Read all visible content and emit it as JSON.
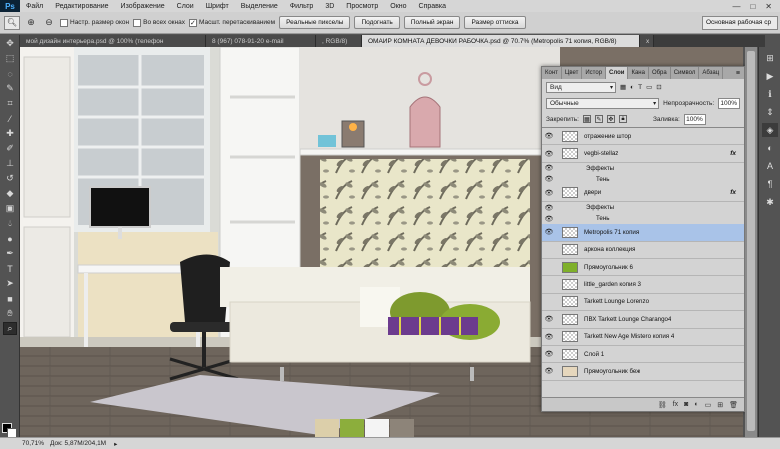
{
  "menubar": {
    "logo": "Ps",
    "items": [
      "Файл",
      "Редактирование",
      "Изображение",
      "Слои",
      "Шрифт",
      "Выделение",
      "Фильтр",
      "3D",
      "Просмотр",
      "Окно",
      "Справка"
    ],
    "window_controls": [
      "—",
      "□",
      "✕"
    ]
  },
  "options": {
    "resize_windows": "Настр. размер окон",
    "all_windows": "Во всех окнах",
    "scrubby_zoom": "Масшт. перетаскиванием",
    "actual_pixels": "Реальные пикселы",
    "fit_screen": "Подогнать",
    "fill_screen": "Полный экран",
    "print_size": "Размер оттиска",
    "workspace": "Основная рабочая ср"
  },
  "tabs": [
    {
      "label": "мой дизайн интерьера.psd @ 100% (телефон",
      "active": false
    },
    {
      "label": "8 (967) 078-91-20 e-mail",
      "active": false
    },
    {
      "label": ", RGB/8)",
      "active": false
    },
    {
      "label": "ОМАИР КОМНАТА ДЕВОЧКИ РАБОЧКА.psd @ 70.7% (Metropolis 71 копия, RGB/8)",
      "active": true
    },
    {
      "label": "x",
      "active": false
    }
  ],
  "layers_panel": {
    "tabs": [
      "Конт",
      "Цвет",
      "Истор",
      "Слои",
      "Кана",
      "Обра",
      "Символ",
      "Абзац"
    ],
    "active_tab": "Слои",
    "filter_kind": "Вид",
    "blend_mode": "Обычные",
    "opacity_label": "Непрозрачность:",
    "opacity_value": "100%",
    "lock_label": "Закрепить:",
    "fill_label": "Заливка:",
    "fill_value": "100%",
    "layers": [
      {
        "name": "отражение штор",
        "visible": true,
        "fx": false,
        "type": "layer"
      },
      {
        "name": "vegbi-stellaz",
        "visible": true,
        "fx": true,
        "type": "layer"
      },
      {
        "name": "Эффекты",
        "type": "effects"
      },
      {
        "name": "Тень",
        "type": "effect"
      },
      {
        "name": "двери",
        "visible": true,
        "fx": true,
        "type": "layer"
      },
      {
        "name": "Эффекты",
        "type": "effects"
      },
      {
        "name": "Тень",
        "type": "effect"
      },
      {
        "name": "Metropolis 71 копия",
        "visible": true,
        "fx": false,
        "type": "layer",
        "active": true
      },
      {
        "name": "арконa коллекция",
        "visible": false,
        "fx": false,
        "type": "layer"
      },
      {
        "name": "Прямоугольник 6",
        "visible": false,
        "fx": false,
        "type": "layer"
      },
      {
        "name": "little_garden копия 3",
        "visible": false,
        "fx": false,
        "type": "layer"
      },
      {
        "name": "Tarkett Lounge Lorenzo",
        "visible": false,
        "fx": false,
        "type": "layer"
      },
      {
        "name": "ПВХ Tarkett Lounge Charango4",
        "visible": true,
        "fx": false,
        "type": "layer"
      },
      {
        "name": "Tarkett New Age Mistero копия 4",
        "visible": true,
        "fx": false,
        "type": "layer"
      },
      {
        "name": "Слой 1",
        "visible": true,
        "fx": false,
        "type": "layer"
      },
      {
        "name": "Прямоугольник беж",
        "visible": true,
        "fx": false,
        "type": "layer"
      }
    ],
    "footer_icons": [
      "link-icon",
      "fx-icon",
      "mask-icon",
      "adjustment-icon",
      "folder-icon",
      "new-layer-icon",
      "trash-icon"
    ]
  },
  "status": {
    "zoom": "70,71%",
    "doc": "Док: 5,87M/204,1M"
  },
  "colors": {
    "accent": "#4fb2ff",
    "selection": "#a9c3e8"
  }
}
